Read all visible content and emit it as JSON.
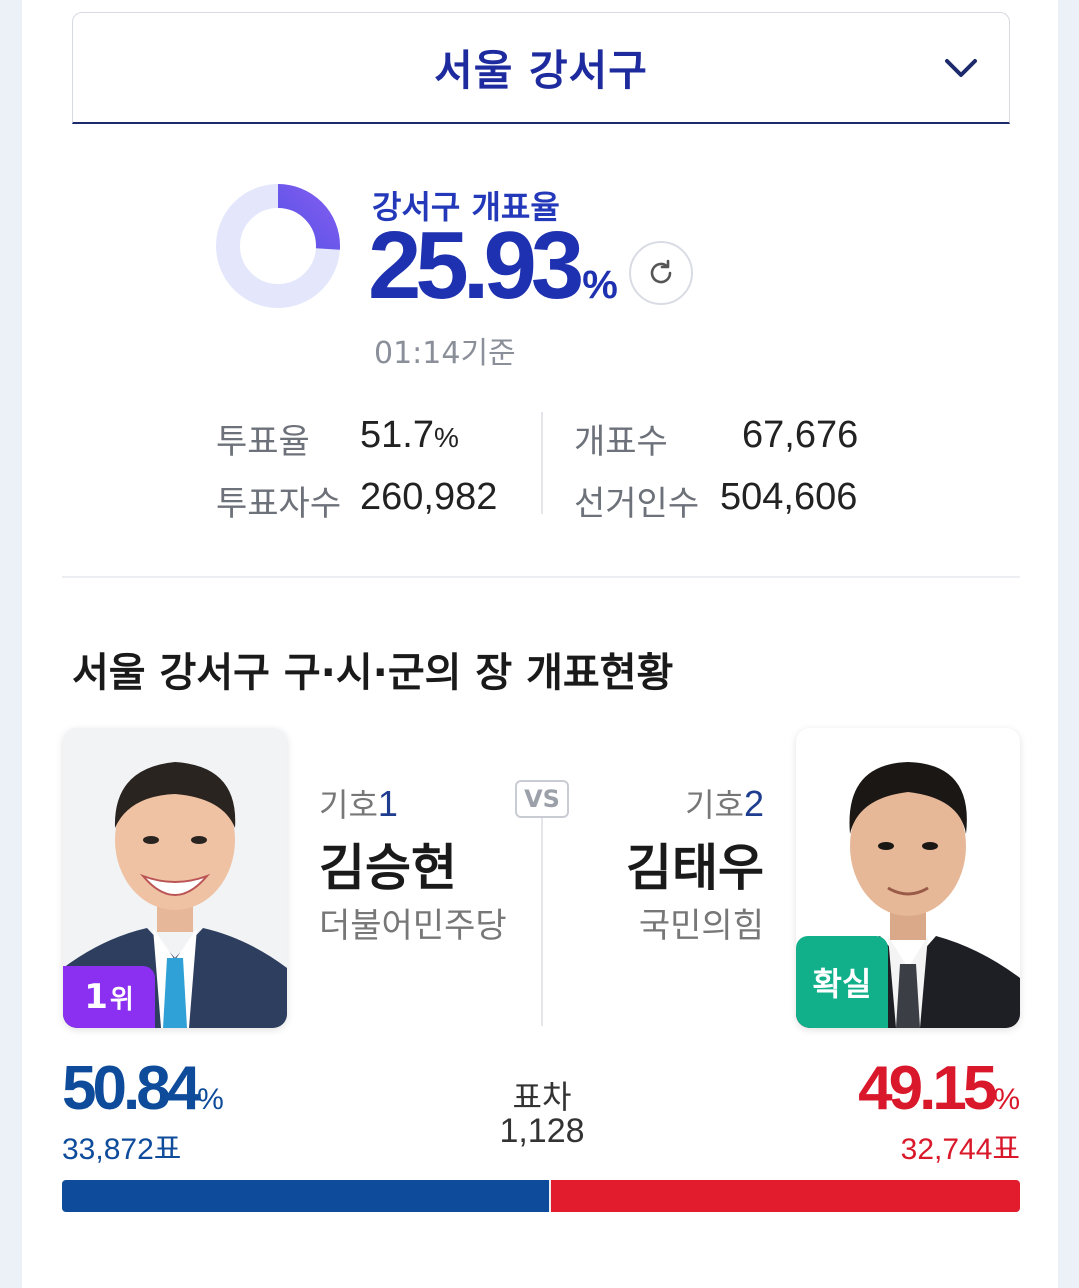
{
  "region": {
    "title": "서울 강서구",
    "icon": "chevron-down-icon"
  },
  "count": {
    "label": "강서구 개표율",
    "rate": "25.93",
    "rate_unit": "%",
    "rate_fraction": 0.2593,
    "time": "01:14기준",
    "refresh_icon": "refresh-icon",
    "donut_colors": {
      "track": "#e4e7fb",
      "fill_start": "#2b47d9",
      "fill_end": "#7f5cf0"
    }
  },
  "stats": {
    "turnout_label": "투표율",
    "turnout_value": "51.7",
    "turnout_unit": "%",
    "voters_label": "투표자수",
    "voters_value": "260,982",
    "counted_label": "개표수",
    "counted_value": "67,676",
    "electorate_label": "선거인수",
    "electorate_value": "504,606"
  },
  "section": {
    "title": "서울 강서구 구·시·군의 장 개표현황"
  },
  "candidates": {
    "left": {
      "num_label": "기호",
      "num": "1",
      "name": "김승현",
      "party": "더불어민주당",
      "badge": "1",
      "badge_suffix": "위",
      "percent": "50.84",
      "percent_unit": "%",
      "votes": "33,872표",
      "color": "#0e4c9b"
    },
    "right": {
      "num_label": "기호",
      "num": "2",
      "name": "김태우",
      "party": "국민의힘",
      "badge": "확실",
      "percent": "49.15",
      "percent_unit": "%",
      "votes": "32,744표",
      "color": "#d9192b"
    },
    "vs": "VS",
    "gap_label": "표차",
    "gap_value": "1,128",
    "bar_share_left": 0.5084
  }
}
